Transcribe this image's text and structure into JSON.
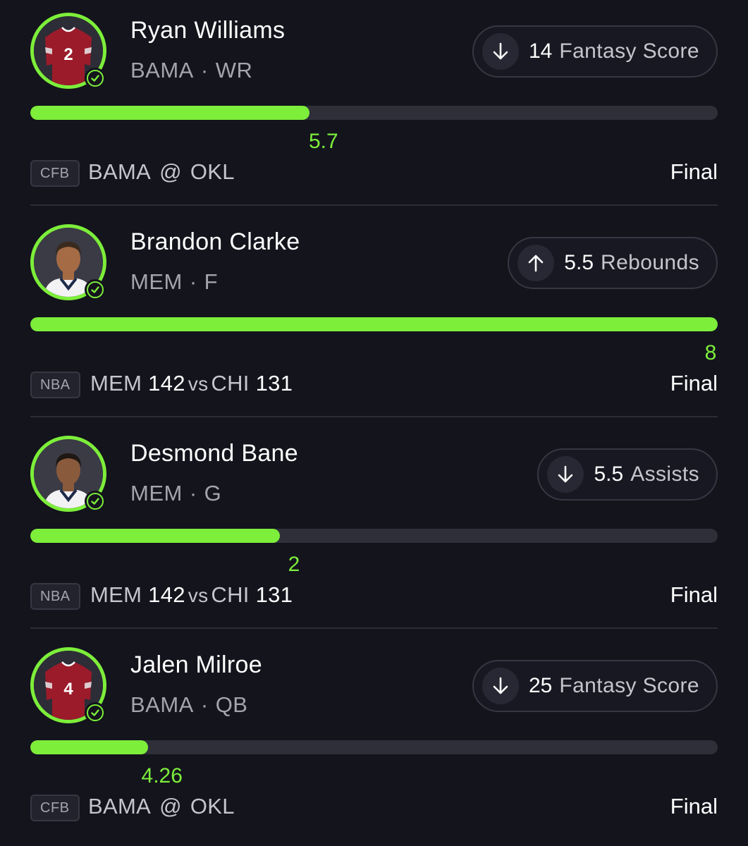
{
  "picks": [
    {
      "player": "Ryan Williams",
      "team": "BAMA",
      "position": "WR",
      "avatar_type": "jersey",
      "jersey_number": "2",
      "direction": "down",
      "arrow_icon": "arrow-down-icon",
      "line": "14",
      "stat": "Fantasy Score",
      "actual": "5.7",
      "progress_fraction": 0.406,
      "league": "CFB",
      "matchup": {
        "away": "BAMA",
        "sep": "@",
        "home": "OKL",
        "away_score": "",
        "home_score": ""
      },
      "status": "Final"
    },
    {
      "player": "Brandon Clarke",
      "team": "MEM",
      "position": "F",
      "avatar_type": "headshot",
      "jersey_number": "",
      "direction": "up",
      "arrow_icon": "arrow-up-icon",
      "line": "5.5",
      "stat": "Rebounds",
      "actual": "8",
      "progress_fraction": 1.0,
      "league": "NBA",
      "matchup": {
        "away": "MEM",
        "sep": "vs",
        "home": "CHI",
        "away_score": "142",
        "home_score": "131"
      },
      "status": "Final"
    },
    {
      "player": "Desmond Bane",
      "team": "MEM",
      "position": "G",
      "avatar_type": "headshot",
      "jersey_number": "",
      "direction": "down",
      "arrow_icon": "arrow-down-icon",
      "line": "5.5",
      "stat": "Assists",
      "actual": "2",
      "progress_fraction": 0.363,
      "league": "NBA",
      "matchup": {
        "away": "MEM",
        "sep": "vs",
        "home": "CHI",
        "away_score": "142",
        "home_score": "131"
      },
      "status": "Final"
    },
    {
      "player": "Jalen Milroe",
      "team": "BAMA",
      "position": "QB",
      "avatar_type": "jersey",
      "jersey_number": "4",
      "direction": "down",
      "arrow_icon": "arrow-down-icon",
      "line": "25",
      "stat": "Fantasy Score",
      "actual": "4.26",
      "progress_fraction": 0.171,
      "league": "CFB",
      "matchup": {
        "away": "BAMA",
        "sep": "@",
        "home": "OKL",
        "away_score": "",
        "home_score": ""
      },
      "status": "Final"
    }
  ],
  "colors": {
    "background": "#13141c",
    "accent_green": "#7dee3a",
    "jersey_red": "#9b1b2a",
    "muted_text": "#a3a4ad"
  }
}
